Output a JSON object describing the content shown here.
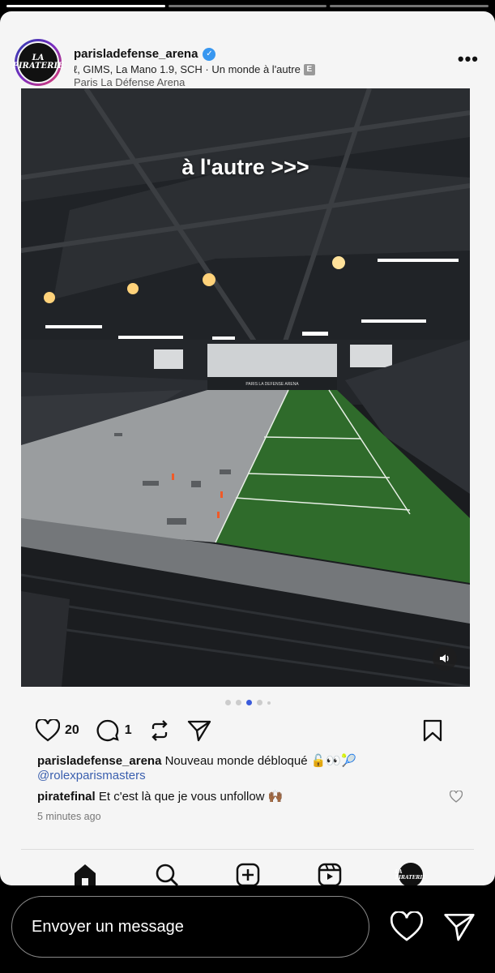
{
  "story": {
    "progress_segments": 3,
    "progress_done": 1
  },
  "post": {
    "username": "parisladefense_arena",
    "music_overlap": "piratefinal",
    "music": "ℓ, GIMS, La Mano 1.9, SCH · Un monde à l'autre",
    "explicit_badge": "E",
    "location": "Paris La Défense Arena",
    "overlay_text": "à l'autre >>>",
    "arena_banner": "PARIS LA DEFENSE ARENA",
    "likes": "20",
    "comments": "1",
    "caption_user": "parisladefense_arena",
    "caption_text": "Nouveau monde débloqué 🔓👀🎾",
    "caption_mention": "@rolexparismasters",
    "comment_user": "piratefinal",
    "comment_text": "Et c'est là que je vous unfollow 🙌🏾",
    "time": "5 minutes ago",
    "avatar_text": "LA PIRATERIE",
    "carousel_total": 5,
    "carousel_active": 3
  },
  "reply": {
    "placeholder": "Envoyer un message"
  },
  "colors": {
    "verified": "#3897f0",
    "mention": "#3a5fae",
    "active_dot": "#3b5bdb",
    "turf": "#2f6b2b"
  }
}
